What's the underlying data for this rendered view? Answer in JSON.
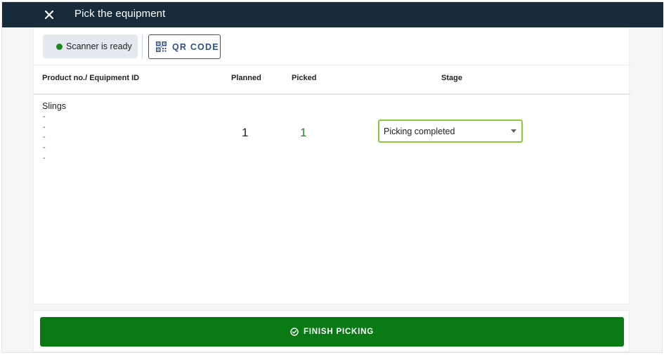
{
  "header": {
    "title": "Pick the equipment",
    "close_icon": "close-icon"
  },
  "toolbar": {
    "scanner_status": "Scanner is ready",
    "scanner_status_color": "#1e8a1e",
    "qr_button_label": "QR CODE",
    "qr_icon": "qr-code-icon"
  },
  "table": {
    "columns": [
      "Product no./ Equipment ID",
      "Planned",
      "Picked",
      "Stage"
    ],
    "rows": [
      {
        "product": "Slings",
        "equipment_ids": [
          "-",
          "-",
          "-",
          "-",
          "-"
        ],
        "planned": "1",
        "picked": "1",
        "stage": "Picking completed"
      }
    ]
  },
  "footer": {
    "finish_label": "FINISH PICKING",
    "finish_icon": "check-circle-icon",
    "finish_color": "#0a7a14"
  },
  "colors": {
    "header_bg": "#172b3a",
    "accent_blue": "#2f4f86",
    "select_border": "#8dc63f"
  }
}
